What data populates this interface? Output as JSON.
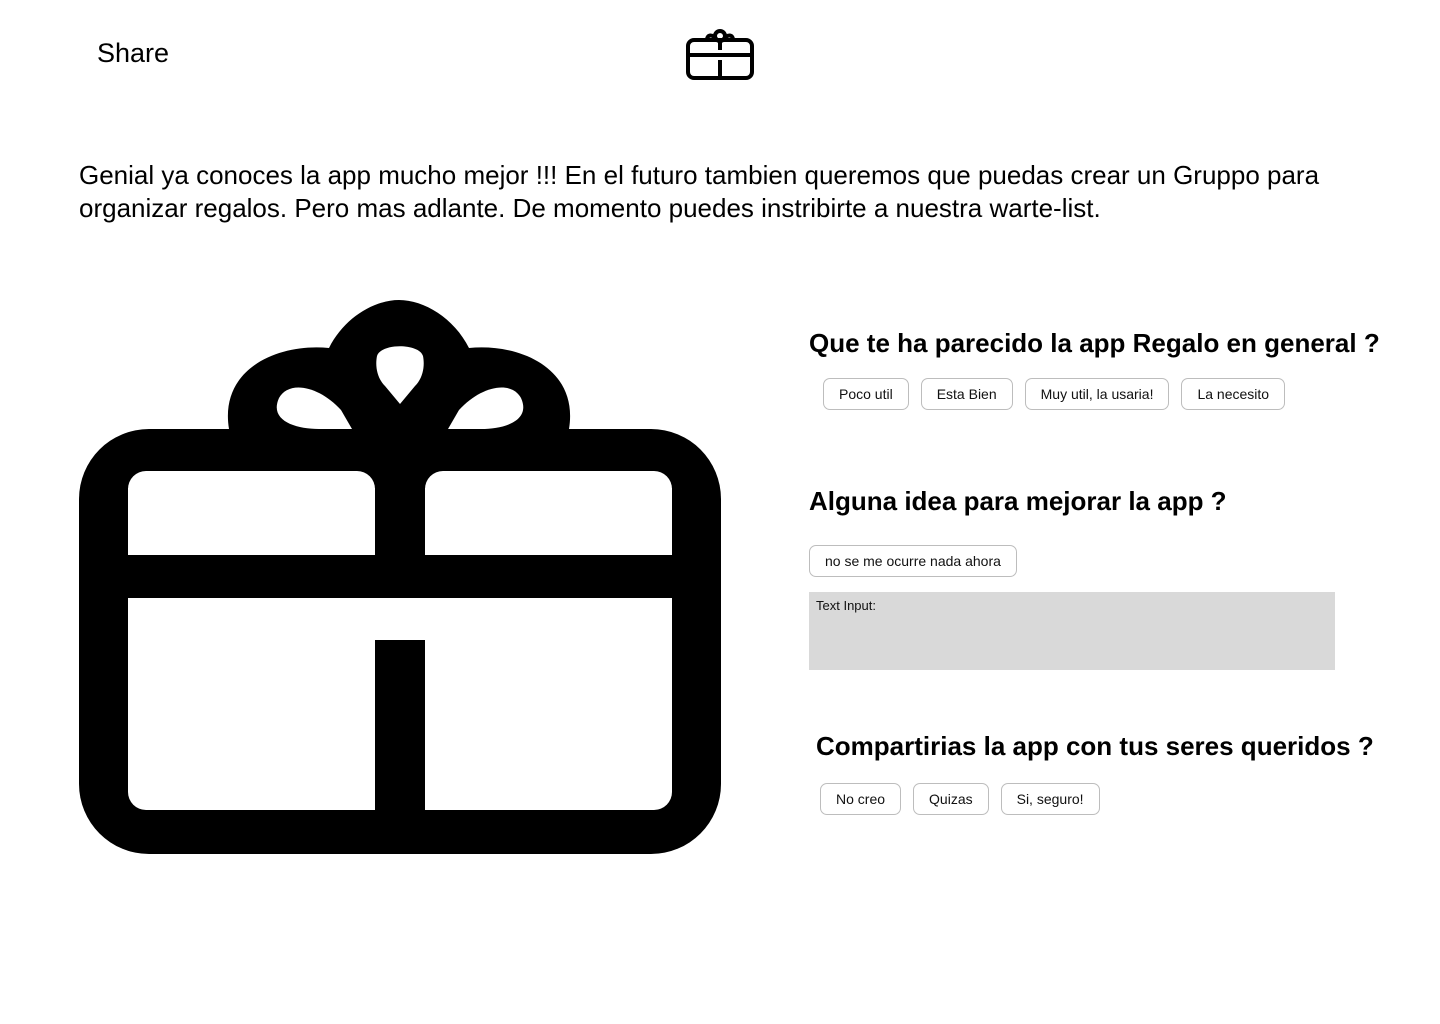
{
  "header": {
    "share_label": "Share",
    "logo_icon": "gift-icon"
  },
  "intro": {
    "text": "Genial ya conoces la app mucho mejor !!! En el futuro tambien queremos que puedas crear un Gruppo para organizar regalos. Pero mas adlante. De momento puedes instribirte a nuestra warte-list."
  },
  "hero": {
    "icon": "gift-icon"
  },
  "survey": {
    "q1": {
      "question": "Que te ha parecido la app Regalo en general ?",
      "options": [
        "Poco util",
        "Esta Bien",
        "Muy util, la usaria!",
        "La necesito"
      ]
    },
    "q2": {
      "question": "Alguna idea para mejorar la app ?",
      "options": [
        "no se me ocurre nada ahora"
      ],
      "input_label": "Text Input:"
    },
    "q3": {
      "question": "Compartirias la app con tus seres queridos ?",
      "options": [
        "No creo",
        "Quizas",
        "Si, seguro!"
      ]
    }
  },
  "colors": {
    "text": "#000000",
    "input_bg": "#d9d9d9",
    "chip_border": "#bdbdbd"
  }
}
